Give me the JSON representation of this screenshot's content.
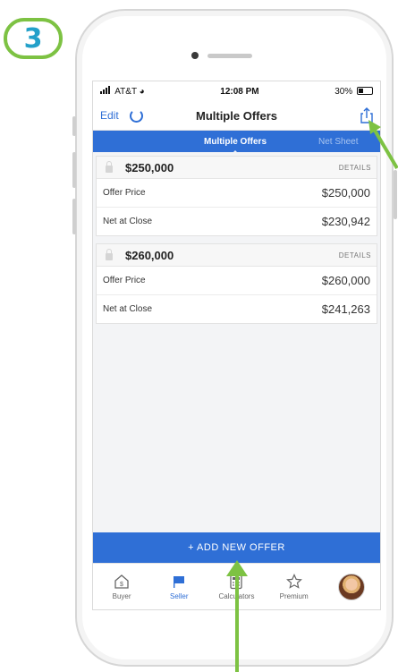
{
  "step": {
    "number": "3"
  },
  "status_bar": {
    "carrier": "AT&T",
    "time": "12:08 PM",
    "battery": "30%"
  },
  "nav": {
    "edit_label": "Edit",
    "title": "Multiple Offers"
  },
  "segments": {
    "active": "Multiple Offers",
    "inactive": "Net Sheet"
  },
  "offers": [
    {
      "amount": "$250,000",
      "details_label": "DETAILS",
      "rows": [
        {
          "label": "Offer Price",
          "value": "$250,000"
        },
        {
          "label": "Net at Close",
          "value": "$230,942"
        }
      ]
    },
    {
      "amount": "$260,000",
      "details_label": "DETAILS",
      "rows": [
        {
          "label": "Offer Price",
          "value": "$260,000"
        },
        {
          "label": "Net at Close",
          "value": "$241,263"
        }
      ]
    }
  ],
  "add_offer_label": "+ ADD NEW OFFER",
  "tabs": [
    {
      "label": "Buyer",
      "icon": "house-icon"
    },
    {
      "label": "Seller",
      "icon": "flag-icon",
      "active": true
    },
    {
      "label": "Calculators",
      "icon": "calculator-icon"
    },
    {
      "label": "Premium",
      "icon": "star-icon"
    },
    {
      "label": "",
      "icon": "profile-avatar"
    }
  ],
  "colors": {
    "accent_blue": "#2f6fd6",
    "annotation_green": "#7dc243",
    "step_number": "#23a0c9"
  }
}
